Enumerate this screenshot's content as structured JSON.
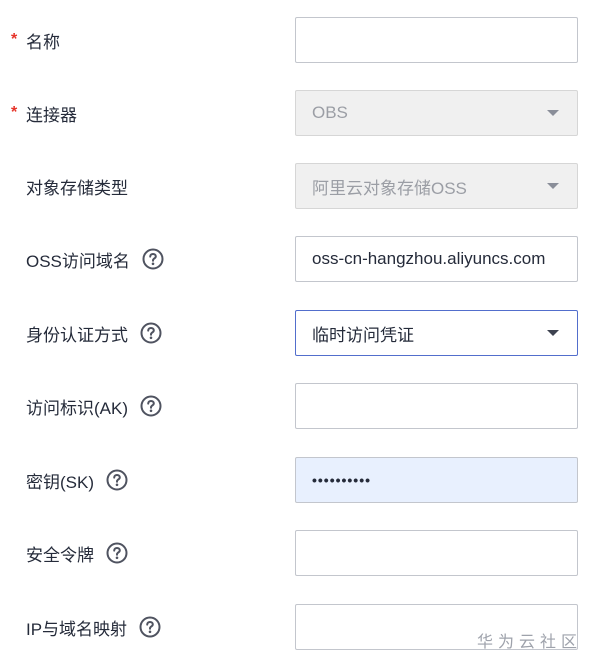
{
  "form": {
    "name": {
      "label": "名称",
      "required_mark": "*",
      "value": ""
    },
    "connector": {
      "label": "连接器",
      "required_mark": "*",
      "value": "OBS"
    },
    "storage_type": {
      "label": "对象存储类型",
      "value": "阿里云对象存储OSS"
    },
    "oss_domain": {
      "label": "OSS访问域名",
      "value": "oss-cn-hangzhou.aliyuncs.com"
    },
    "auth_method": {
      "label": "身份认证方式",
      "value": "临时访问凭证"
    },
    "access_key": {
      "label": "访问标识(AK)",
      "value": ""
    },
    "secret_key": {
      "label": "密钥(SK)",
      "value": "••••••••••"
    },
    "security_token": {
      "label": "安全令牌",
      "value": ""
    },
    "ip_domain_mapping": {
      "label": "IP与域名映射",
      "value": ""
    }
  },
  "watermark": "华为云社区",
  "colors": {
    "required": "#e6342a",
    "active_border": "#526ecc",
    "disabled_bg": "#f0f0f0",
    "autofill_bg": "#e8f0fe"
  },
  "icons": {
    "help": "question-circle-icon",
    "dropdown": "caret-down-icon"
  }
}
